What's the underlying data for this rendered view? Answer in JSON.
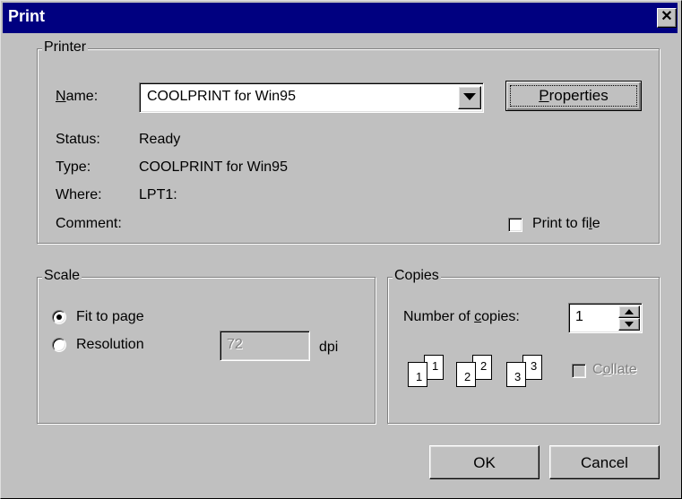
{
  "window": {
    "title": "Print"
  },
  "printer": {
    "legend": "Printer",
    "name_label": "Name:",
    "name_value": "COOLPRINT for Win95",
    "properties_label": "Properties",
    "status_label": "Status:",
    "status_value": "Ready",
    "type_label": "Type:",
    "type_value": "COOLPRINT for Win95",
    "where_label": "Where:",
    "where_value": "LPT1:",
    "comment_label": "Comment:",
    "comment_value": "",
    "print_to_file_label": "Print to file",
    "print_to_file_checked": false
  },
  "scale": {
    "legend": "Scale",
    "fit_label": "Fit to page",
    "fit_selected": true,
    "resolution_label": "Resolution",
    "resolution_value": "72",
    "dpi_label": "dpi"
  },
  "copies": {
    "legend": "Copies",
    "number_label": "Number of copies:",
    "number_value": "1",
    "collate_label": "Collate",
    "collate_enabled": false,
    "pages": [
      "1",
      "2",
      "3"
    ]
  },
  "buttons": {
    "ok": "OK",
    "cancel": "Cancel"
  },
  "icons": [
    "close-icon",
    "dropdown-arrow-icon",
    "spin-up-icon",
    "spin-down-icon",
    "collate-pages-icon"
  ]
}
